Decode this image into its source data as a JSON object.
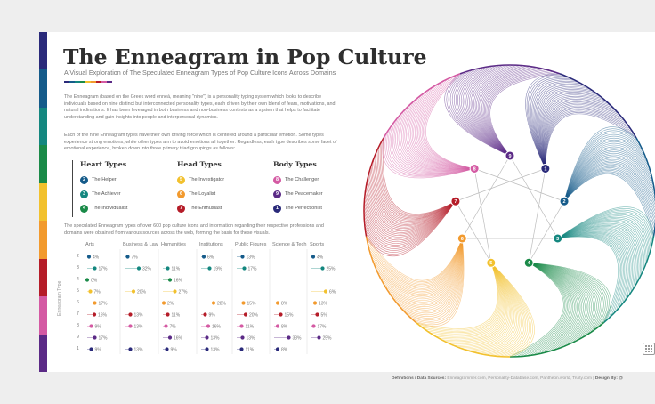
{
  "title": "The Enneagram in Pop Culture",
  "subtitle": "A Visual Exploration of The Speculated Enneagram Types of Pop Culture Icons Across Domains",
  "intro_p1": "The Enneagram (based on the Greek word enneá, meaning \"nine\") is a personality typing system which looks to describe individuals based on nine distinct but interconnected personality types, each driven by their own blend of fears, motivations, and natural inclinations. It has been leveraged in both business and non-business contexts as a system that helps to facilitate understanding and gain insights into people and interpersonal dynamics.",
  "intro_p2": "Each of the nine Enneagram types have their own driving force which is centered around a particular emotion. Some types experience strong emotions, while other types aim to avoid emotions all together. Regardless, each type describes some facet of emotional experience, broken down into three primary triad groupings as follows:",
  "intro_p3": "The speculated Enneagram types of over 600 pop culture icons and information regarding their respective professions and domains were obtained from various sources across the web, forming the basis for these visuals.",
  "colors": {
    "1": "#2a2a7a",
    "2": "#155b8a",
    "3": "#14877f",
    "4": "#1a8a48",
    "5": "#f2c12e",
    "6": "#f29a2e",
    "7": "#b51c28",
    "8": "#d45aa3",
    "9": "#5b2a86"
  },
  "stripe_colors": [
    "#2a2a7a",
    "#155b8a",
    "#14877f",
    "#1a8a48",
    "#f2c12e",
    "#f29a2e",
    "#b51c28",
    "#d45aa3",
    "#5b2a86"
  ],
  "groups": [
    {
      "title": "Heart Types",
      "items": [
        {
          "num": "2",
          "label": "The Helper"
        },
        {
          "num": "3",
          "label": "The Achiever"
        },
        {
          "num": "4",
          "label": "The Individualist"
        }
      ]
    },
    {
      "title": "Head Types",
      "items": [
        {
          "num": "5",
          "label": "The Investigator"
        },
        {
          "num": "6",
          "label": "The Loyalist"
        },
        {
          "num": "7",
          "label": "The Enthusiast"
        }
      ]
    },
    {
      "title": "Body Types",
      "items": [
        {
          "num": "8",
          "label": "The Challenger"
        },
        {
          "num": "9",
          "label": "The Peacemaker"
        },
        {
          "num": "1",
          "label": "The Perfectionist"
        }
      ]
    }
  ],
  "footer": {
    "label": "Definitions / Data Sources:",
    "text": "Enneagrammer.com, Personality-Database.com, Pantheon.world, Truity.com |",
    "design_label": "Design By: @"
  },
  "chart_data": [
    {
      "type": "table",
      "title": "",
      "ylabel": "Enneagram Type",
      "rows": [
        "2",
        "3",
        "4",
        "5",
        "6",
        "7",
        "8",
        "9",
        "1"
      ],
      "columns": [
        "Arts",
        "Business & Law",
        "Humanities",
        "Institutions",
        "Public Figures",
        "Science & Tech",
        "Sports"
      ],
      "series": [
        {
          "name": "Arts",
          "values": [
            4,
            17,
            0,
            7,
            17,
            16,
            9,
            17,
            9
          ]
        },
        {
          "name": "Business & Law",
          "values": [
            7,
            32,
            null,
            20,
            null,
            13,
            13,
            null,
            13
          ]
        },
        {
          "name": "Humanities",
          "values": [
            null,
            11,
            16,
            27,
            2,
            11,
            7,
            16,
            9
          ]
        },
        {
          "name": "Institutions",
          "values": [
            6,
            19,
            null,
            null,
            28,
            9,
            16,
            13,
            13
          ]
        },
        {
          "name": "Public Figures",
          "values": [
            13,
            17,
            null,
            null,
            15,
            20,
            11,
            13,
            11
          ]
        },
        {
          "name": "Science & Tech",
          "values": [
            null,
            null,
            null,
            null,
            8,
            15,
            8,
            33,
            8
          ]
        },
        {
          "name": "Sports",
          "values": [
            4,
            25,
            null,
            32,
            8,
            13,
            5,
            17,
            25
          ]
        }
      ],
      "cell_labels": [
        [
          "4%",
          "7%",
          "",
          "6%",
          "13%",
          "",
          "4%"
        ],
        [
          "17%",
          "32%",
          "11%",
          "19%",
          "17%",
          "",
          "25%"
        ],
        [
          "0%",
          "",
          "16%",
          "",
          "",
          "",
          ""
        ],
        [
          "7%",
          "20%",
          "27%",
          "",
          "",
          "32%",
          "6%"
        ],
        [
          "17%",
          "",
          "2%",
          "28%",
          "15%",
          "8%",
          "13%"
        ],
        [
          "16%",
          "13%",
          "11%",
          "9%",
          "20%",
          "15%",
          "5%"
        ],
        [
          "9%",
          "13%",
          "7%",
          "16%",
          "11%",
          "8%",
          "17%"
        ],
        [
          "17%",
          "",
          "16%",
          "13%",
          "13%",
          "33%",
          "25%"
        ],
        [
          "9%",
          "13%",
          "9%",
          "13%",
          "11%",
          "8%",
          ""
        ]
      ]
    },
    {
      "type": "diagram",
      "title": "",
      "nodes": [
        "9",
        "1",
        "2",
        "3",
        "4",
        "5",
        "6",
        "7",
        "8"
      ]
    }
  ]
}
